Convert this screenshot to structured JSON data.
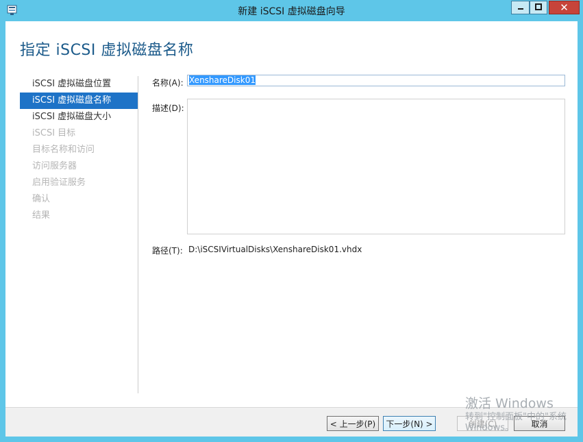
{
  "window": {
    "title": "新建 iSCSI 虚拟磁盘向导",
    "minimize_glyph": "▁",
    "maximize_glyph": "□",
    "close_glyph": "✕"
  },
  "page": {
    "title": "指定 iSCSI 虚拟磁盘名称"
  },
  "nav": {
    "items": [
      {
        "label": "iSCSI 虚拟磁盘位置",
        "state": "enabled"
      },
      {
        "label": "iSCSI 虚拟磁盘名称",
        "state": "selected"
      },
      {
        "label": "iSCSI 虚拟磁盘大小",
        "state": "enabled"
      },
      {
        "label": "iSCSI 目标",
        "state": "disabled"
      },
      {
        "label": "目标名称和访问",
        "state": "disabled"
      },
      {
        "label": "访问服务器",
        "state": "disabled"
      },
      {
        "label": "启用验证服务",
        "state": "disabled"
      },
      {
        "label": "确认",
        "state": "disabled"
      },
      {
        "label": "结果",
        "state": "disabled"
      }
    ]
  },
  "form": {
    "name_label": "名称(A):",
    "name_value": "XenshareDisk01",
    "description_label": "描述(D):",
    "description_value": "",
    "path_label": "路径(T):",
    "path_value": "D:\\iSCSIVirtualDisks\\XenshareDisk01.vhdx"
  },
  "footer": {
    "prev_label": "< 上一步(P)",
    "next_label": "下一步(N) >",
    "create_label": "创建(C)",
    "cancel_label": "取消"
  },
  "watermark": {
    "title": "激活 Windows",
    "line1": "转到\"控制面板\"中的\"系统",
    "line2": "Windows。"
  },
  "colors": {
    "title_bar": "#5ec6e8",
    "accent": "#1e73c7",
    "page_title": "#1b5a8a"
  }
}
